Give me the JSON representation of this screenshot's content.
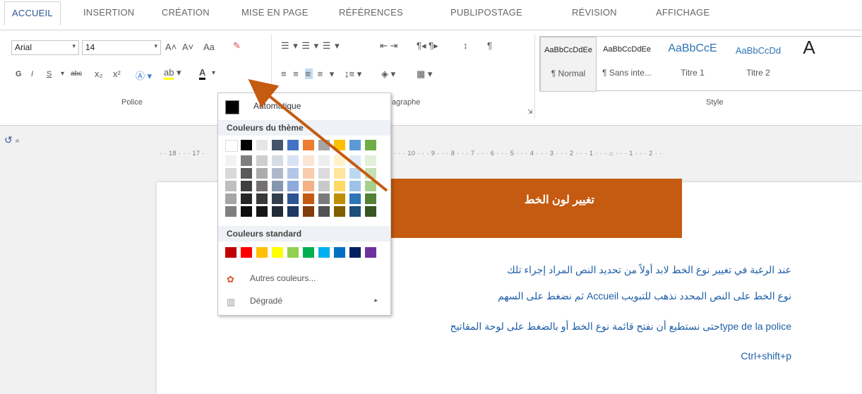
{
  "tabs": [
    "ACCUEIL",
    "INSERTION",
    "CRÉATION",
    "MISE EN PAGE",
    "RÉFÉRENCES",
    "PUBLIPOSTAGE",
    "RÉVISION",
    "AFFICHAGE"
  ],
  "font": {
    "name": "Arial",
    "size": "14",
    "grow": "A˄",
    "shrink": "A˅",
    "case": "Aa",
    "clear": "A"
  },
  "format_row": {
    "bold": "G",
    "italic": "I",
    "underline": "S",
    "strike": "abc",
    "subscript": "x₂",
    "superscript": "x²",
    "color_button": "A"
  },
  "groups": {
    "police": "Police",
    "paragraphe": "agraphe",
    "style": "Style"
  },
  "styles": [
    {
      "preview": "AaBbCcDdEe",
      "name": "¶ Normal"
    },
    {
      "preview": "AaBbCcDdEe",
      "name": "¶ Sans inte..."
    },
    {
      "preview": "AaBbCcE",
      "name": "Titre 1"
    },
    {
      "preview": "AaBbCcDd",
      "name": "Titre 2"
    },
    {
      "preview": "A",
      "name": ""
    }
  ],
  "color_menu": {
    "automatic": "Automatique",
    "theme_header": "Couleurs du thème",
    "standard_header": "Couleurs standard",
    "more_colors": "Autres couleurs...",
    "gradient": "Dégradé",
    "theme_columns": [
      [
        "#ffffff",
        "#f2f2f2",
        "#d9d9d9",
        "#bfbfbf",
        "#a6a6a6",
        "#808080"
      ],
      [
        "#000000",
        "#7f7f7f",
        "#595959",
        "#3f3f3f",
        "#262626",
        "#0d0d0d"
      ],
      [
        "#e7e6e6",
        "#d0cece",
        "#aeabab",
        "#757171",
        "#3a3838",
        "#171616"
      ],
      [
        "#44546a",
        "#d6dce4",
        "#adb9ca",
        "#8496b0",
        "#333f4f",
        "#222a35"
      ],
      [
        "#4472c4",
        "#d9e2f3",
        "#b4c6e7",
        "#8eaadb",
        "#2f5496",
        "#1f3864"
      ],
      [
        "#ed7d31",
        "#fbe5d5",
        "#f7cbac",
        "#f4b183",
        "#c55a11",
        "#833c0b"
      ],
      [
        "#a5a5a5",
        "#ededed",
        "#dbdbdb",
        "#c9c9c9",
        "#7b7b7b",
        "#525252"
      ],
      [
        "#ffc000",
        "#fff2cc",
        "#fee599",
        "#ffd965",
        "#bf8f00",
        "#7f5f00"
      ],
      [
        "#5b9bd5",
        "#deebf6",
        "#bdd7ee",
        "#9cc3e5",
        "#2e75b5",
        "#1e4e79"
      ],
      [
        "#70ad47",
        "#e2efd9",
        "#c5e0b3",
        "#a8d08d",
        "#538135",
        "#375623"
      ]
    ],
    "standard_colors": [
      "#c00000",
      "#ff0000",
      "#ffc000",
      "#ffff00",
      "#92d050",
      "#00b050",
      "#00b0f0",
      "#0070c0",
      "#002060",
      "#7030a0"
    ]
  },
  "ruler": "· · 18 · · · 17 ·",
  "ruler_right": "· 11 · · · 10 · · · 9 · · · 8 · · · 7 · · · 6 · · · 5 · · · 4 · · · 3 · · · 2 · · · 1 · · · ⌂ · · · 1 · · · 2 · ·",
  "callout": "تغيير لون الخط",
  "document": {
    "line1": "عند الرغبة في تغيير نوع الخط لابد أولاً من تحديد النص المراد إجراء تلك",
    "line2": "نوع الخط على النص المحدد نذهب للتبويب Accueil ثم نضغط على السهم",
    "line3": "type de la policeحتى نستطيع أن نفتح قائمة نوع الخط أو بالضغط على لوحة المفاتيح",
    "line4": "Ctrl+shift+p"
  },
  "colors": {
    "accent": "#2b579a",
    "callout": "#c55a11",
    "doc_text": "#1f5fa8"
  }
}
